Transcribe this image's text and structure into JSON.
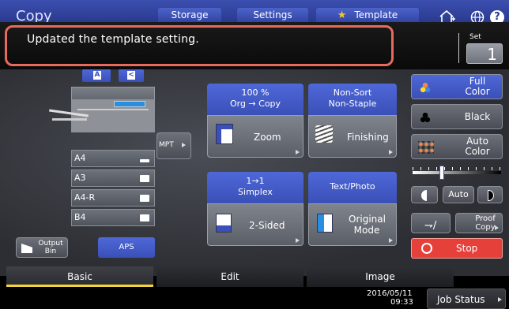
{
  "header": {
    "app_title": "Copy",
    "tabs": [
      "Storage",
      "Settings",
      "Template"
    ]
  },
  "message": {
    "text": "Updated the template setting."
  },
  "set": {
    "label": "Set",
    "value": "1"
  },
  "original": {
    "a_label": "A",
    "mpt_label": "MPT",
    "output_bin_label": "Output Bin",
    "aps_label": "APS"
  },
  "paper_trays": [
    "A4",
    "A3",
    "A4-R",
    "B4"
  ],
  "functions": {
    "zoom": {
      "header_line1": "100 %",
      "header_line2": "Org  →  Copy",
      "label": "Zoom"
    },
    "finishing": {
      "header_line1": "Non-Sort",
      "header_line2": "Non-Staple",
      "label": "Finishing"
    },
    "two_sided": {
      "header_line1": "1→1",
      "header_line2": "Simplex",
      "label": "2-Sided"
    },
    "original_mode": {
      "header_line1": "Text/Photo",
      "label": "Original Mode"
    }
  },
  "color": {
    "full_color": "Full Color",
    "black": "Black",
    "auto_color": "Auto Color",
    "density_level": 0.32,
    "auto_density": "Auto",
    "proof_copy": "Proof Copy",
    "stop": "Stop",
    "stop_color": "#e5403a"
  },
  "bottom_tabs": [
    "Basic",
    "Edit",
    "Image"
  ],
  "status": {
    "date": "2016/05/11",
    "time": "09:33",
    "job_status": "Job Status"
  },
  "icons": [
    "home-icon",
    "globe-icon",
    "help-icon",
    "star-icon",
    "pages-icon",
    "reverse-icon",
    "zoom-icon",
    "finishing-icon",
    "duplex-icon",
    "original-mode-icon",
    "full-color-icon",
    "black-icon",
    "auto-color-icon",
    "stop-icon",
    "proof-icon"
  ]
}
